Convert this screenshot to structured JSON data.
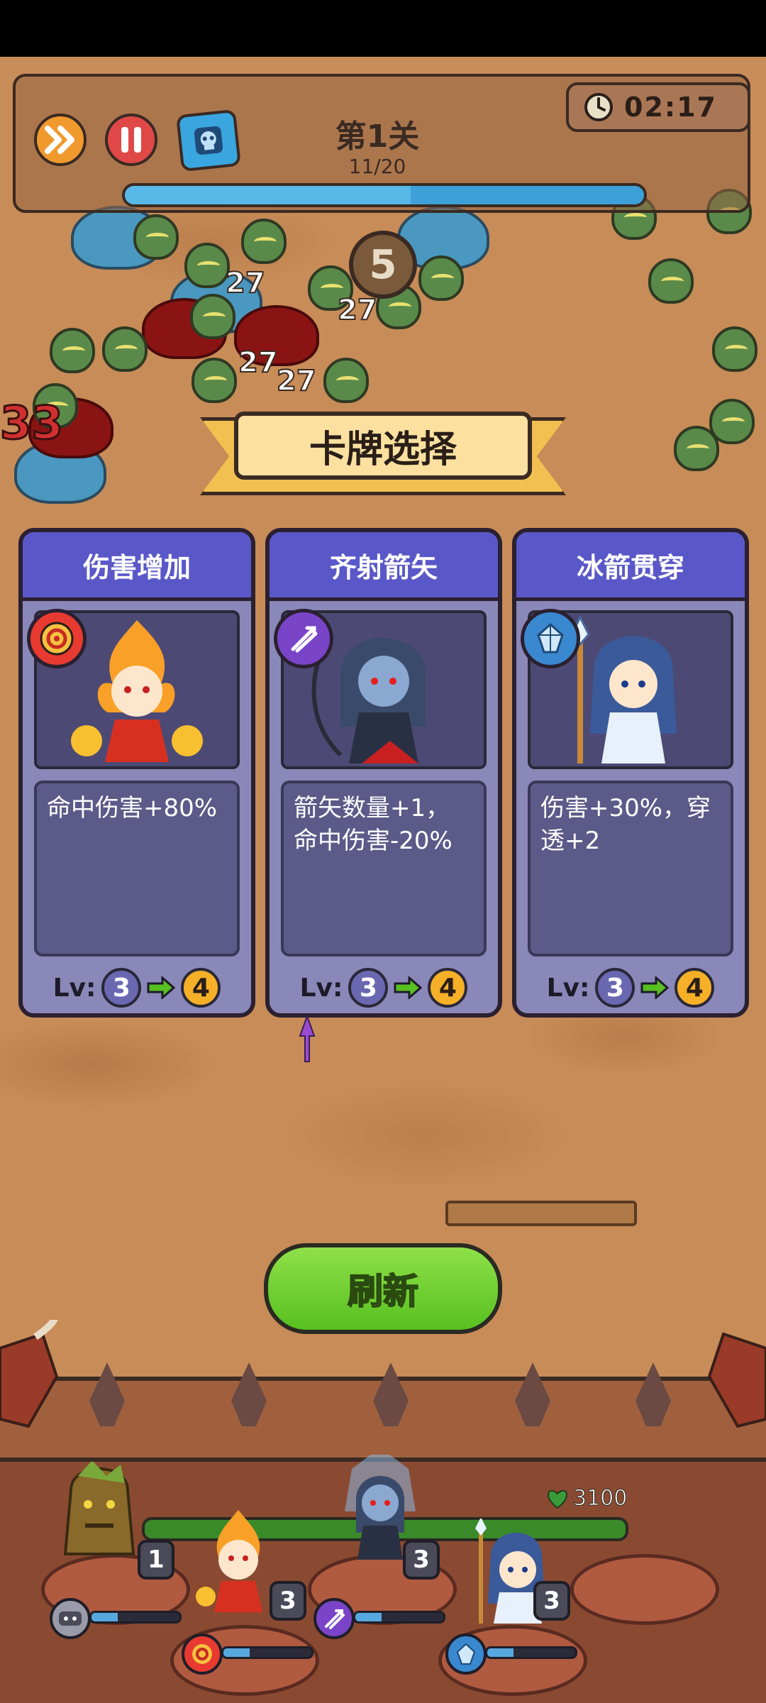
{
  "hud": {
    "level_title": "第1关",
    "wave_progress": "11/20",
    "wave_fill": 0.55,
    "timer": "02:17"
  },
  "wave_counter": "5",
  "damage_numbers": [
    "27",
    "27",
    "27",
    "27",
    "33"
  ],
  "dialog": {
    "title": "卡牌选择",
    "cards": [
      {
        "title": "伤害增加",
        "desc": "命中伤害+80%",
        "lv_label": "Lv:",
        "lv_from": "3",
        "lv_to": "4",
        "badge_color": "#e83a30",
        "icon": "target-icon"
      },
      {
        "title": "齐射箭矢",
        "desc": "箭矢数量+1，\n命中伤害-20%",
        "lv_label": "Lv:",
        "lv_from": "3",
        "lv_to": "4",
        "badge_color": "#7a44c8",
        "icon": "arrows-icon"
      },
      {
        "title": "冰箭贯穿",
        "desc": "伤害+30%，穿\n透+2",
        "lv_label": "Lv:",
        "lv_from": "3",
        "lv_to": "4",
        "badge_color": "#3a88d0",
        "icon": "ice-crystal-icon"
      }
    ],
    "refresh_label": "刷新"
  },
  "base": {
    "hp": "3100",
    "heroes": [
      {
        "name": "tree-golem",
        "level": "1"
      },
      {
        "name": "fire-mage",
        "level": "3"
      },
      {
        "name": "dark-archer",
        "level": "3"
      },
      {
        "name": "ice-mage",
        "level": "3"
      }
    ]
  },
  "colors": {
    "accent_green": "#58c020",
    "card_header": "#5a58c8",
    "level_orange": "#f6b028"
  }
}
